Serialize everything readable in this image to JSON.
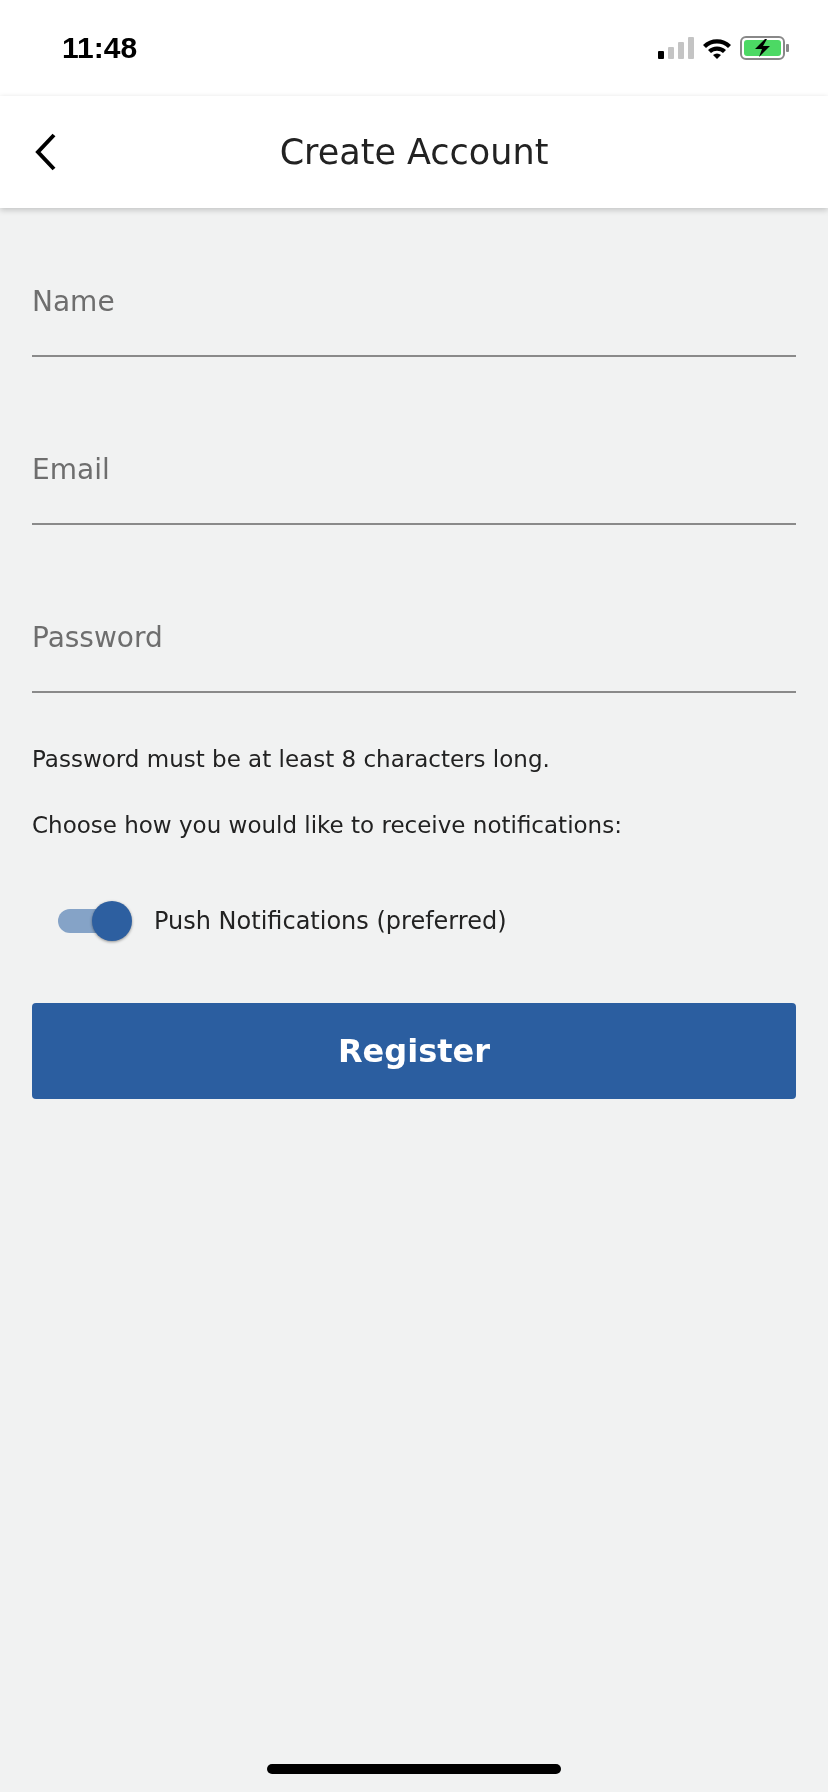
{
  "status_bar": {
    "time": "11:48"
  },
  "nav": {
    "title": "Create Account"
  },
  "fields": [
    {
      "placeholder": "Name"
    },
    {
      "placeholder": "Email"
    },
    {
      "placeholder": "Password"
    }
  ],
  "hint": "Password must be at least 8 characters long.",
  "prompt": "Choose how you would like to receive notifications:",
  "toggles": [
    {
      "label": "Push Notifications (preferred)",
      "on": true
    }
  ],
  "button": {
    "label": "Register"
  }
}
